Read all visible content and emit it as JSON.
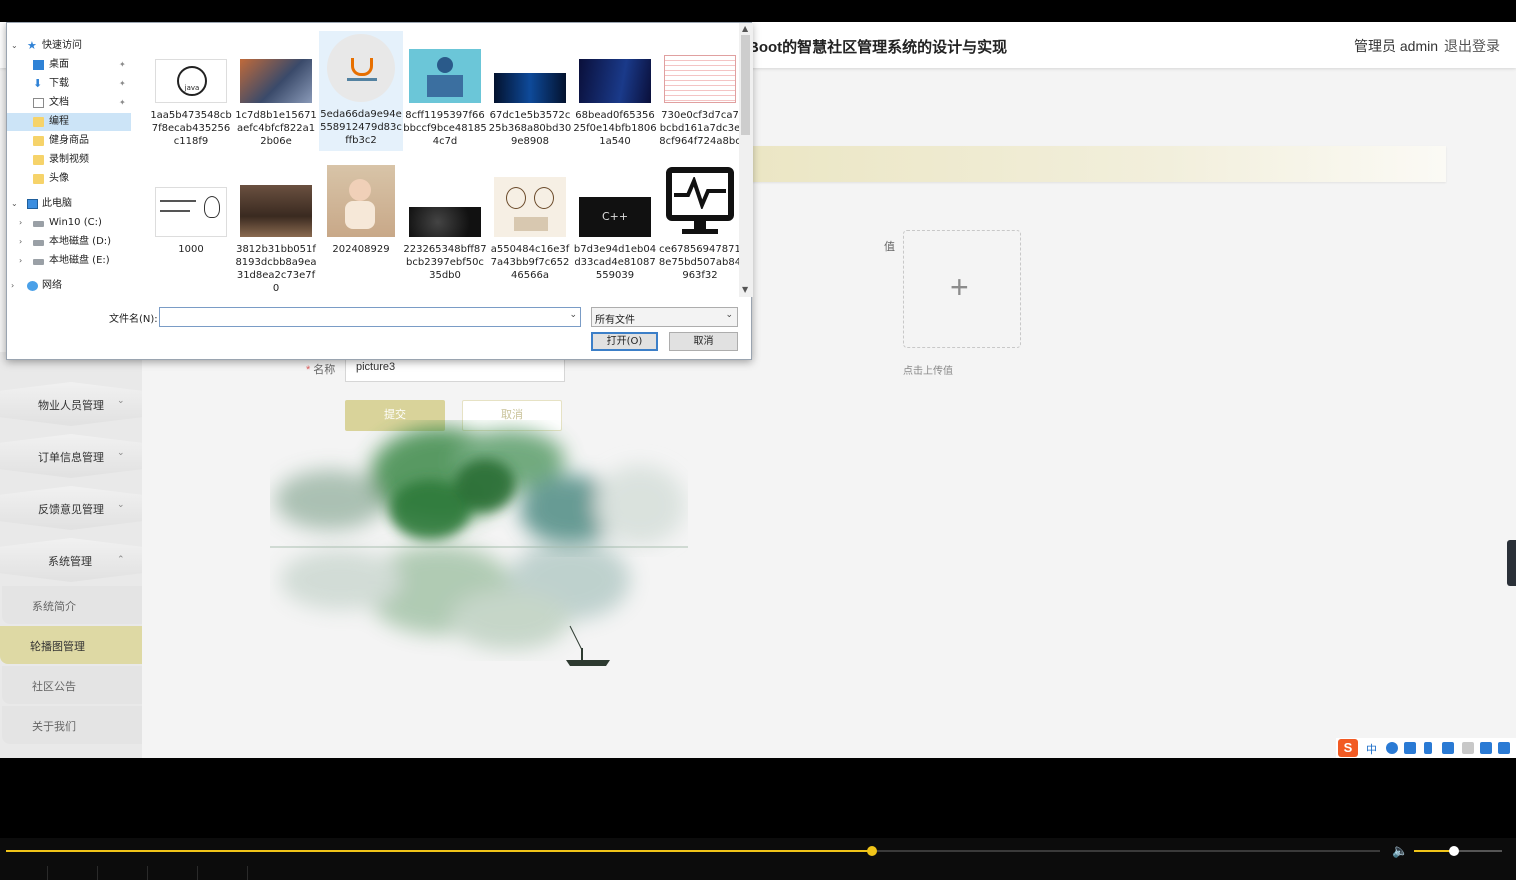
{
  "app": {
    "title": "Boot的智慧社区管理系统的设计与实现",
    "admin_role": "管理员 admin",
    "logout": "退出登录"
  },
  "sidebar": {
    "menus": [
      {
        "label": "物业人员管理",
        "chevron": "chevron-down"
      },
      {
        "label": "订单信息管理",
        "chevron": "chevron-down"
      },
      {
        "label": "反馈意见管理",
        "chevron": "chevron-down"
      },
      {
        "label": "系统管理",
        "chevron": "chevron-up"
      }
    ],
    "submenu": [
      {
        "label": "系统简介",
        "active": false
      },
      {
        "label": "轮播图管理",
        "active": true
      },
      {
        "label": "社区公告",
        "active": false
      },
      {
        "label": "关于我们",
        "active": false
      }
    ]
  },
  "form": {
    "name_label": "名称",
    "name_value": "picture3",
    "submit": "提交",
    "cancel": "取消",
    "value_label": "值",
    "upload_hint": "点击上传值"
  },
  "dialog": {
    "nav": [
      {
        "label": "快速访问",
        "icon": "star-icon"
      },
      {
        "label": "桌面",
        "icon": "desktop-icon",
        "pinned": true
      },
      {
        "label": "下载",
        "icon": "download-icon",
        "pinned": true
      },
      {
        "label": "文档",
        "icon": "document-icon",
        "pinned": true
      },
      {
        "label": "编程",
        "icon": "folder-icon",
        "selected": true
      },
      {
        "label": "健身商品",
        "icon": "folder-icon"
      },
      {
        "label": "录制视频",
        "icon": "folder-icon"
      },
      {
        "label": "头像",
        "icon": "folder-icon"
      },
      {
        "label": "此电脑",
        "icon": "computer-icon"
      },
      {
        "label": "Win10 (C:)",
        "icon": "drive-icon"
      },
      {
        "label": "本地磁盘 (D:)",
        "icon": "drive-icon"
      },
      {
        "label": "本地磁盘 (E:)",
        "icon": "drive-icon"
      },
      {
        "label": "网络",
        "icon": "network-icon"
      }
    ],
    "files": [
      {
        "name": "1aa5b473548cb7f8ecab435256c118f9",
        "kind": "java-logo"
      },
      {
        "name": "1c7d8b1e15671aefc4bfcf822a12b06e",
        "kind": "laptop-photo"
      },
      {
        "name": "5eda66da9e94e558912479d83cffb3c2",
        "kind": "java-cup",
        "hover": true
      },
      {
        "name": "8cff1195397f66bbccf9bce481854c7d",
        "kind": "programmer-illustration"
      },
      {
        "name": "67dc1e5b3572c25b368a80bd309e8908",
        "kind": "blue-tech"
      },
      {
        "name": "68bead0f6535625f0e14bfb18061a540",
        "kind": "binary-code"
      },
      {
        "name": "730e0cf3d7ca7bcbd161a7dc3e8cf964f724a8bc",
        "kind": "spreadsheet"
      },
      {
        "name": "1000",
        "kind": "sketch"
      },
      {
        "name": "3812b31bb051f8193dcbb8a9ea31d8ea2c73e7f0",
        "kind": "meeting-room"
      },
      {
        "name": "202408929",
        "kind": "baby-photo"
      },
      {
        "name": "223265348bff87bcb2397ebf50c35db0",
        "kind": "dark-tech"
      },
      {
        "name": "a550484c16e3f7a43bb9f7c65246566a",
        "kind": "cartoon"
      },
      {
        "name": "b7d3e94d1eb04d33cad4e81087559039",
        "kind": "cpp-dark"
      },
      {
        "name": "ce67856947871 8e75bd507ab84963f32",
        "kind": "monitor-icon"
      }
    ],
    "filename_label": "文件名(N):",
    "filename_value": "",
    "filter_value": "所有文件",
    "open_button": "打开(O)",
    "cancel_button": "取消"
  },
  "ime": {
    "mode": "中"
  },
  "player": {
    "progress": 0.63,
    "volume": 0.45
  },
  "colors": {
    "accent": "#d9d39a",
    "active_menu": "#ded9a4",
    "progress": "#f0c419"
  }
}
